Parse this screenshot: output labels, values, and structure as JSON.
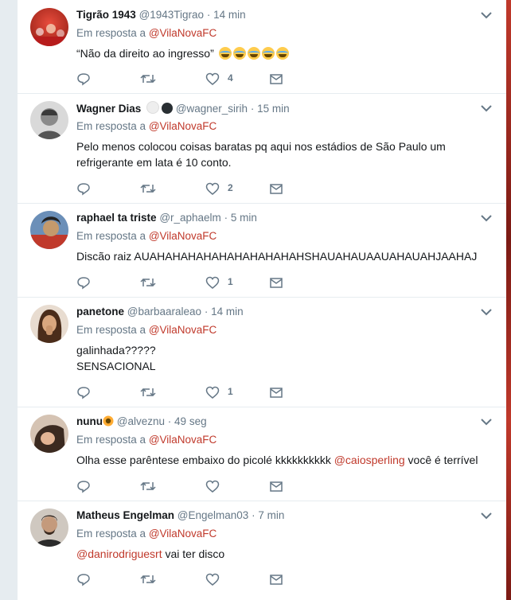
{
  "reply_prefix": "Em resposta a",
  "tweets": [
    {
      "name": "Tigrão 1943",
      "handle": "@1943Tigrao",
      "separator": "·",
      "time": "14 min",
      "reply_to": "@VilaNovaFC",
      "text": "“Não da direito ao ingresso” ",
      "likes": "4"
    },
    {
      "name": "Wagner Dias",
      "handle": "@wagner_sirih",
      "separator": "·",
      "time": "15 min",
      "reply_to": "@VilaNovaFC",
      "text": "Pelo menos colocou coisas baratas pq aqui nos estádios de São Paulo um\nrefrigerante em lata é 10 conto.",
      "likes": "2"
    },
    {
      "name": "raphael ta triste",
      "handle": "@r_aphaelm",
      "separator": "·",
      "time": "5 min",
      "reply_to": "@VilaNovaFC",
      "text": "Discão raiz AUAHAHAHAHAHAHAHAHAHAHSHAUAHAUAAUAHAUAHJAAHAJ",
      "likes": "1"
    },
    {
      "name": "panetone",
      "handle": "@barbaaraleao",
      "separator": "·",
      "time": "14 min",
      "reply_to": "@VilaNovaFC",
      "text": "galinhada?????\nSENSACIONAL",
      "likes": "1"
    },
    {
      "name": "nunu",
      "handle": "@alveznu",
      "separator": "·",
      "time": "49 seg",
      "reply_to": "@VilaNovaFC",
      "text_before": "Olha esse parêntese embaixo do picolé kkkkkkkkkk ",
      "text_mention": "@caiosperling",
      "text_after": " você é terrível",
      "likes": ""
    },
    {
      "name": "Matheus Engelman",
      "handle": "@Engelman03",
      "separator": "·",
      "time": "7 min",
      "reply_to": "@VilaNovaFC",
      "text_mention": "@danirodriguesrt",
      "text_after": " vai ter disco",
      "likes": ""
    }
  ],
  "colors": {
    "link": "#c0392b",
    "meta": "#657786",
    "divider": "#e6ecf0"
  },
  "icons": [
    "reply-icon",
    "retweet-icon",
    "like-icon",
    "direct-message-icon",
    "chevron-down-icon"
  ]
}
